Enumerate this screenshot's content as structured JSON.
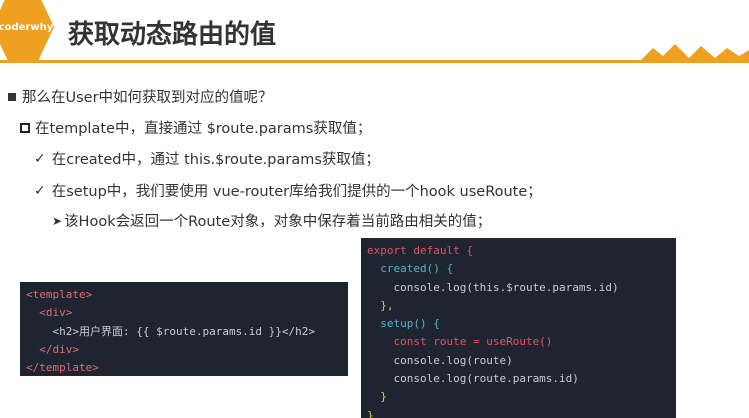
{
  "header": {
    "logo_text": "coderwhy",
    "title": "获取动态路由的值"
  },
  "bullets": {
    "level1": "那么在User中如何获取到对应的值呢？",
    "level2": "在template中，直接通过 $route.params获取值；",
    "level3a": "在created中，通过 this.$route.params获取值；",
    "level3b": "在setup中，我们要使用 vue-router库给我们提供的一个hook useRoute；",
    "level4": "该Hook会返回一个Route对象，对象中保存着当前路由相关的值；"
  },
  "code_template": {
    "lines": [
      "<template>",
      "  <div>",
      "    <h2>用户界面: {{ $route.params.id }}</h2>",
      "  </div>",
      "</template>"
    ]
  },
  "code_script": {
    "lines": [
      "export default {",
      "  created() {",
      "    console.log(this.$route.params.id)",
      "  },",
      "  setup() {",
      "    const route = useRoute()",
      "    console.log(route)",
      "    console.log(route.params.id)",
      "  }",
      "}"
    ]
  },
  "colors": {
    "accent": "#f0a020",
    "code_bg": "#1e2430"
  }
}
